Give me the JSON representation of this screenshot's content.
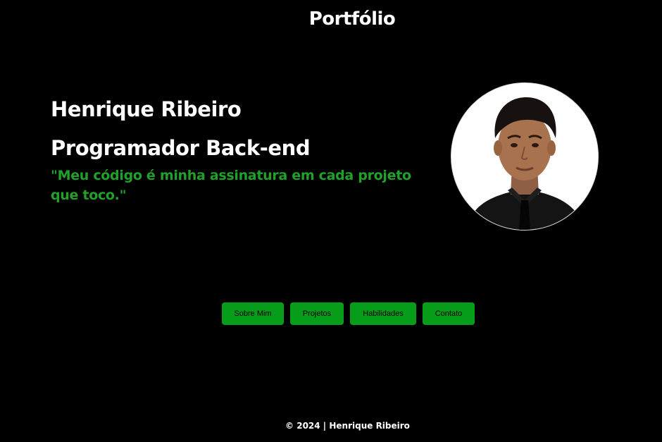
{
  "header": {
    "title": "Portfólio"
  },
  "hero": {
    "name": "Henrique Ribeiro",
    "role": "Programador Back-end",
    "quote": "\"Meu código é minha assinatura em cada projeto que toco.\""
  },
  "avatar": {
    "icon": "profile-photo"
  },
  "nav": {
    "items": [
      {
        "label": "Sobre Mim"
      },
      {
        "label": "Projetos"
      },
      {
        "label": "Habilidades"
      },
      {
        "label": "Contato"
      }
    ]
  },
  "footer": {
    "text": "© 2024 | Henrique Ribeiro"
  },
  "colors": {
    "background": "#000000",
    "accent": "#079c1a",
    "quote": "#1fa12a",
    "text": "#ffffff"
  }
}
